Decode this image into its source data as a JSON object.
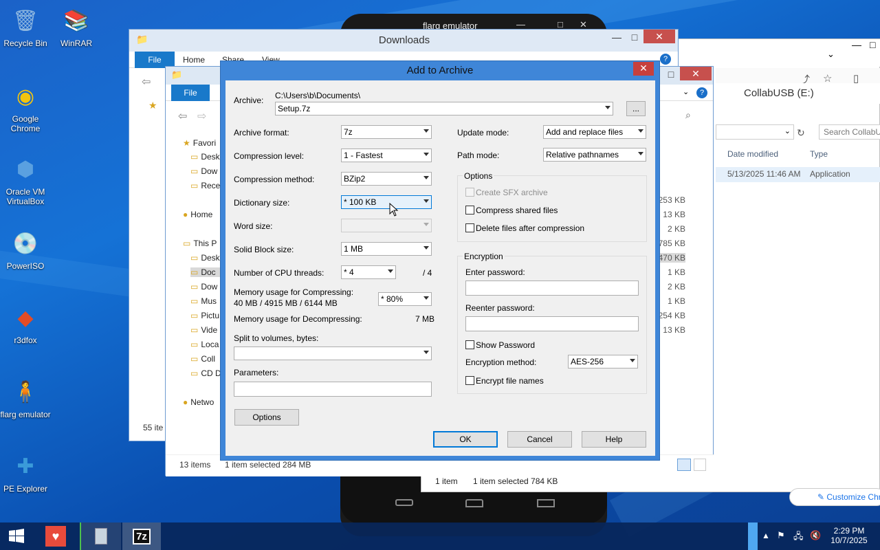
{
  "desktop": {
    "icons": [
      {
        "label": "Recycle Bin",
        "icon": "recycle-bin-icon",
        "glyph": "🗑"
      },
      {
        "label": "WinRAR",
        "icon": "winrar-icon",
        "glyph": "📚"
      },
      {
        "label": "Google Chrome",
        "icon": "chrome-icon",
        "glyph": "◉"
      },
      {
        "label": "Oracle VM VirtualBox",
        "icon": "virtualbox-icon",
        "glyph": "⬢"
      },
      {
        "label": "PowerISO",
        "icon": "poweriso-icon",
        "glyph": "💿"
      },
      {
        "label": "r3dfox",
        "icon": "r3dfox-icon",
        "glyph": "◆"
      },
      {
        "label": "flarg emulator",
        "icon": "flarg-emulator-icon",
        "glyph": "🧍"
      },
      {
        "label": "PE Explorer",
        "icon": "pe-explorer-icon",
        "glyph": "✚"
      }
    ]
  },
  "emulator": {
    "title": "flarg emulator",
    "min": "—",
    "max": "□",
    "close": "✕"
  },
  "downloads_window": {
    "title": "Downloads",
    "tabs": {
      "file": "File",
      "home": "Home",
      "share": "Share",
      "view": "View"
    },
    "status_items": "55 ite"
  },
  "documents_window": {
    "tabs": {
      "file": "File"
    },
    "nav": {
      "favorites": "Favori",
      "desktop": "Desk",
      "downloads": "Dow",
      "recent": "Rece",
      "homegroup": "Home",
      "thispc": "This P",
      "pc_desktop": "Desk",
      "pc_documents": "Doc",
      "pc_downloads": "Dow",
      "music": "Mus",
      "pictures": "Pictu",
      "videos": "Vide",
      "local": "Loca",
      "coll": "Coll",
      "cd": "CD D",
      "network": "Netwo"
    },
    "sizes": [
      "253 KB",
      "13 KB",
      "2 KB",
      "785 KB",
      "470 KB",
      "1 KB",
      "2 KB",
      "1 KB",
      "254 KB",
      "13 KB"
    ],
    "status": {
      "items": "13 items",
      "selected": "1 item selected  284 MB"
    }
  },
  "collab_window": {
    "title": "CollabUSB (E:)",
    "search_placeholder": "Search CollabUS",
    "col_date": "Date modified",
    "col_type": "Type",
    "row": {
      "date": "5/13/2025 11:46 AM",
      "type": "Application"
    },
    "status": {
      "items": "1 item",
      "selected": "1 item selected  784 KB"
    },
    "customize": "Customize Chro"
  },
  "dialog": {
    "title": "Add to Archive",
    "close": "✕",
    "archive_label": "Archive:",
    "archive_path": "C:\\Users\\b\\Documents\\",
    "archive_name": "Setup.7z",
    "browse": "...",
    "archive_format": {
      "label": "Archive format:",
      "value": "7z"
    },
    "compression_level": {
      "label": "Compression level:",
      "value": "1 - Fastest"
    },
    "compression_method": {
      "label": "Compression method:",
      "value": "BZip2"
    },
    "dictionary_size": {
      "label": "Dictionary size:",
      "value": "* 100 KB"
    },
    "word_size": {
      "label": "Word size:",
      "value": ""
    },
    "solid_block": {
      "label": "Solid Block size:",
      "value": "1 MB"
    },
    "cpu_threads": {
      "label": "Number of CPU threads:",
      "value": "* 4",
      "max": "/ 4"
    },
    "mem_compress": {
      "label": "Memory usage for Compressing:",
      "value": "40 MB / 4915 MB / 6144 MB",
      "percent": "* 80%"
    },
    "mem_decompress": {
      "label": "Memory usage for Decompressing:",
      "value": "7 MB"
    },
    "split": {
      "label": "Split to volumes, bytes:",
      "value": ""
    },
    "parameters": {
      "label": "Parameters:",
      "value": ""
    },
    "options_button": "Options",
    "update_mode": {
      "label": "Update mode:",
      "value": "Add and replace files"
    },
    "path_mode": {
      "label": "Path mode:",
      "value": "Relative pathnames"
    },
    "options_group": {
      "title": "Options",
      "sfx": "Create SFX archive",
      "compress_shared": "Compress shared files",
      "delete_after": "Delete files after compression"
    },
    "encryption": {
      "title": "Encryption",
      "enter_pw": "Enter password:",
      "reenter_pw": "Reenter password:",
      "show_pw": "Show Password",
      "method_label": "Encryption method:",
      "method_value": "AES-256",
      "encrypt_names": "Encrypt file names"
    },
    "ok": "OK",
    "cancel": "Cancel",
    "help": "Help"
  },
  "taskbar": {
    "time": "2:29 PM",
    "date": "10/7/2025"
  }
}
